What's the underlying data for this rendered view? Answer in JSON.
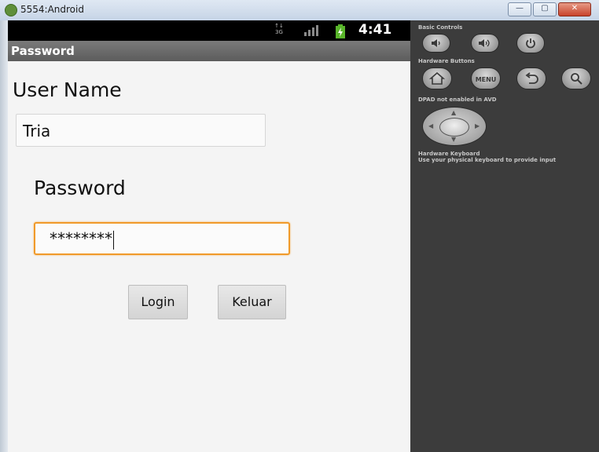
{
  "window": {
    "title": "5554:Android",
    "minimize_glyph": "—",
    "maximize_glyph": "▢",
    "close_glyph": "✕"
  },
  "statusbar": {
    "network_label": "3G",
    "time": "4:41"
  },
  "app": {
    "title": "Password"
  },
  "form": {
    "username_label": "User Name",
    "username_value": "Tria",
    "password_label": "Password",
    "password_value": "********",
    "login_button": "Login",
    "exit_button": "Keluar"
  },
  "emulator": {
    "basic_controls_label": "Basic Controls",
    "hardware_buttons_label": "Hardware Buttons",
    "menu_button": "MENU",
    "dpad_label": "DPAD not enabled in AVD",
    "keyboard_label": "Hardware Keyboard",
    "keyboard_hint": "Use your physical keyboard to provide input"
  },
  "colors": {
    "focus_border": "#f09a2a",
    "panel_bg": "#3c3c3c",
    "actionbar_bg": "#6b6b6b"
  },
  "icons": [
    "android-icon",
    "signal-icon",
    "battery-icon",
    "volume-down-icon",
    "volume-up-icon",
    "power-icon",
    "home-icon",
    "back-icon",
    "search-icon"
  ]
}
